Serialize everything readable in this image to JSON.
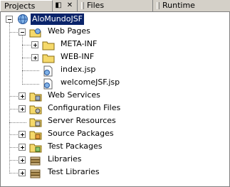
{
  "tabs": [
    {
      "label": "Projects",
      "active": true
    },
    {
      "label": "Files",
      "active": false
    },
    {
      "label": "Runtime",
      "active": false
    }
  ],
  "tab_controls": {
    "restore": "◧",
    "close": "✕"
  },
  "tree": {
    "project": "AloMundoJSF",
    "web_pages": "Web Pages",
    "meta_inf": "META-INF",
    "web_inf": "WEB-INF",
    "index_jsp": "index.jsp",
    "welcome_jsp": "welcomeJSF.jsp",
    "web_services": "Web Services",
    "config_files": "Configuration Files",
    "server_resources": "Server Resources",
    "source_packages": "Source Packages",
    "test_packages": "Test Packages",
    "libraries": "Libraries",
    "test_libraries": "Test Libraries"
  },
  "colors": {
    "selection": "#0a246a",
    "folder": "#f5d96b",
    "chrome": "#d4d0c8"
  }
}
